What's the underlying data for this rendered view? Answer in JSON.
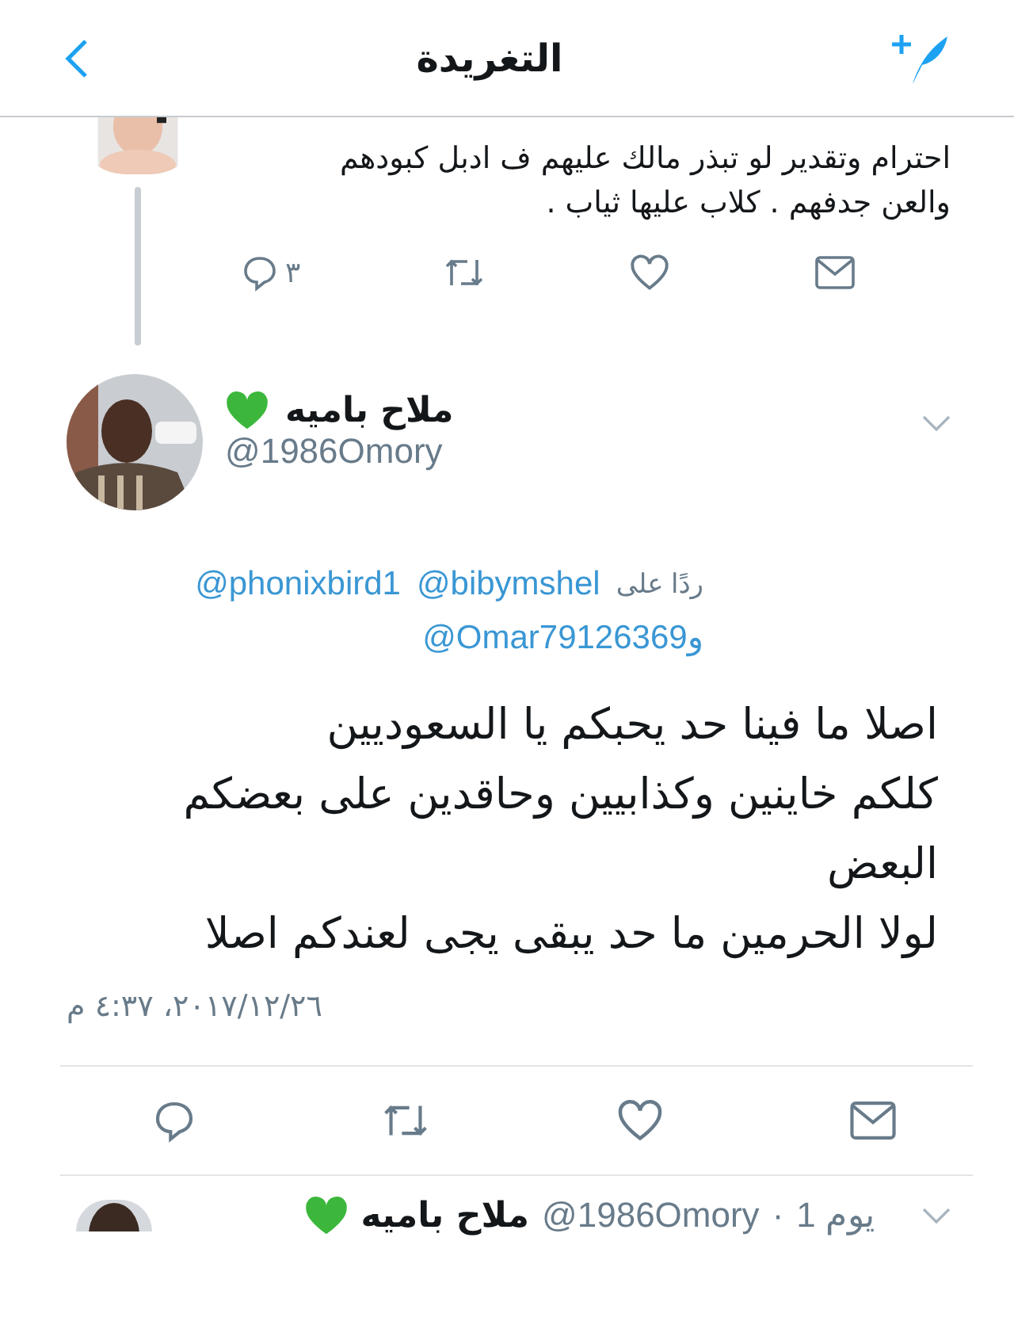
{
  "header": {
    "title": "التغريدة"
  },
  "previous_tweet": {
    "lines": [
      "احترام وتقدير لو تبذر مالك عليهم  ف ادبل كبودهم",
      "والعن جدفهم . كلاب عليها ثياب ."
    ],
    "reply_count": "٣"
  },
  "tweet": {
    "name": "ملاح باميه",
    "handle": "@1986Omory",
    "reply_label": "ردًا على",
    "mentions": [
      "@bibymshel",
      "@phonixbird1"
    ],
    "conjunction": "و",
    "last_mention": "@Omar79126369",
    "lines": [
      "اصلا ما فينا حد يحبكم يا السعوديين",
      "كلكم خاينين وكذابيين وحاقدين على بعضكم البعض",
      "لولا الحرمين ما حد يبقى يجى لعندكم اصلا"
    ],
    "timestamp": "٢٠١٧/١٢/٢٦، ٤:٣٧ م"
  },
  "next_tweet": {
    "name": "ملاح باميه",
    "handle": "@1986Omory",
    "separator": "·",
    "age": "1 يوم"
  }
}
